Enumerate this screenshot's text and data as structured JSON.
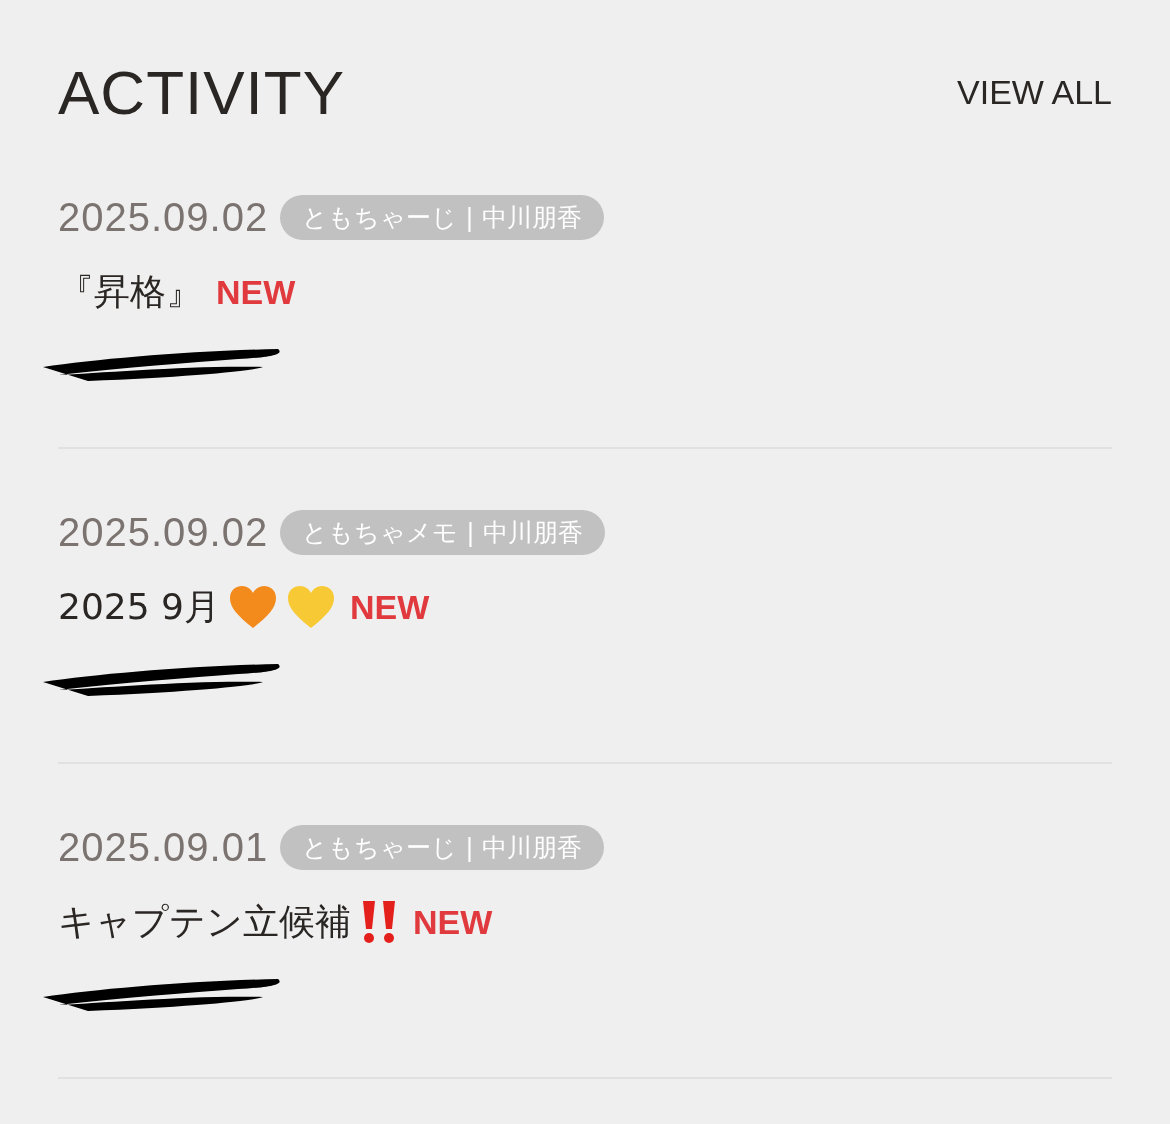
{
  "header": {
    "title": "ACTIVITY",
    "link": "VIEW ALL"
  },
  "items": [
    {
      "date": "2025.09.02",
      "tag": "ともちゃーじ | 中川朋香",
      "title": "『昇格』",
      "badge": "NEW",
      "redacted": true
    },
    {
      "date": "2025.09.02",
      "tag": "ともちゃメモ | 中川朋香",
      "title": "2025 9月",
      "icons": [
        {
          "kind": "heart",
          "color": "#f28a1c"
        },
        {
          "kind": "heart",
          "color": "#f7c934"
        }
      ],
      "badge": "NEW",
      "redacted": true
    },
    {
      "date": "2025.09.01",
      "tag": "ともちゃーじ | 中川朋香",
      "title": "キャプテン立候補",
      "icons": [
        {
          "kind": "double-exclamation",
          "color": "#e3201b"
        }
      ],
      "badge": "NEW",
      "redacted": true
    }
  ]
}
